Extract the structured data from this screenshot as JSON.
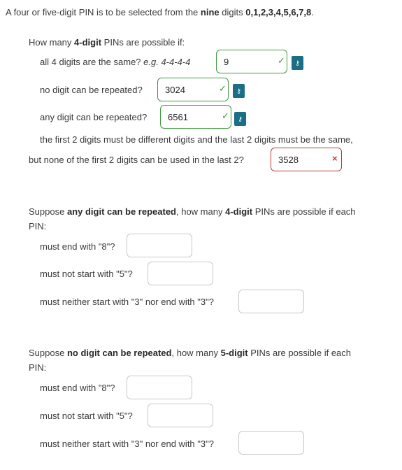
{
  "intro": {
    "prefix": "A four or five-digit PIN is to be selected from the",
    "bold_word": "nine",
    "mid": "digits",
    "digits": "0,1,2,3,4,5,6,7,8",
    "suffix": "."
  },
  "part1": {
    "q_prefix": "How many",
    "q_bold": "4-digit",
    "q_suffix": "PINs are possible if:",
    "items": [
      {
        "label": "all 4 digits are the same?",
        "example": "e.g. 4-4-4-4",
        "value": "9",
        "status": "correct"
      },
      {
        "label": "no digit can be repeated?",
        "value": "3024",
        "status": "correct"
      },
      {
        "label": "any digit can be repeated?",
        "value": "6561",
        "status": "correct"
      }
    ],
    "item4_line1": "the first 2 digits must be different digits and the last 2 digits must be the same,",
    "item4_line2": "but none of the first 2 digits can be used in the last 2?",
    "item4_value": "3528",
    "item4_status": "incorrect"
  },
  "part2": {
    "intro_prefix": "Suppose",
    "intro_bold1": "any digit can be repeated",
    "intro_mid": ", how many",
    "intro_bold2": "4-digit",
    "intro_suffix": "PINs are possible if each",
    "intro_line2": "PIN:",
    "items": [
      {
        "label": "must end with \"8\"?",
        "value": ""
      },
      {
        "label": "must not start with \"5\"?",
        "value": ""
      },
      {
        "label": "must neither start with \"3\" nor end with \"3\"?",
        "value": ""
      }
    ]
  },
  "part3": {
    "intro_prefix": "Suppose",
    "intro_bold1": "no digit can be repeated",
    "intro_mid": ", how many",
    "intro_bold2": "5-digit",
    "intro_suffix": "PINs are possible if each",
    "intro_line2": "PIN:",
    "items": [
      {
        "label": "must end with \"8\"?",
        "value": ""
      },
      {
        "label": "must not start with \"5\"?",
        "value": ""
      },
      {
        "label": "must neither start with \"3\" nor end with \"3\"?",
        "value": ""
      }
    ]
  },
  "icons": {
    "correct": "checkmark-icon",
    "incorrect": "cross-icon",
    "key": "key-icon"
  },
  "colors": {
    "correct": "#3d9a3d",
    "incorrect": "#b73a3a",
    "key_button": "#1a6e86"
  }
}
